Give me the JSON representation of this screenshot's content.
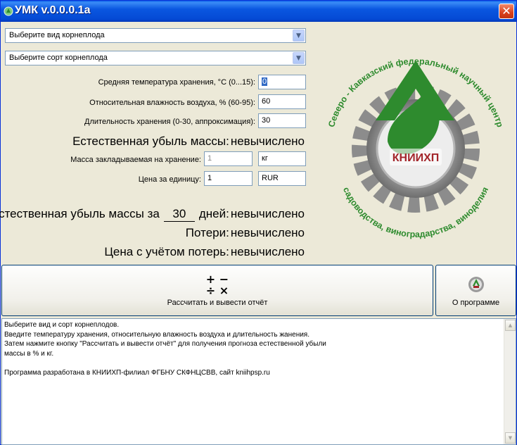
{
  "window": {
    "title": "УМК v.0.0.0.1a",
    "close_glyph": "✕"
  },
  "selectors": {
    "crop_type": "Выберите вид корнеплода",
    "crop_variety": "Выберите сорт корнеплода"
  },
  "params": {
    "temperature_label": "Средняя температура хранения, °С (0...15):",
    "temperature_value": "0",
    "humidity_label": "Относительная влажность воздуха, % (60-95):",
    "humidity_value": "60",
    "duration_label": "Длительность хранения (0-30, аппроксимация):",
    "duration_value": "30"
  },
  "loss": {
    "label": "Естественная убыль массы:",
    "value": "невычислено"
  },
  "mass": {
    "label": "Масса закладываемая на хранение:",
    "value": "1",
    "unit": "кг"
  },
  "price": {
    "label": "Цена за единицу:",
    "value": "1",
    "currency": "RUR"
  },
  "results": {
    "loss_days_prefix": "Естественная убыль массы за",
    "loss_days_value": "30",
    "loss_days_suffix": "дней:",
    "loss_days_result": "невычислено",
    "losses_label": "Потери:",
    "losses_value": "невычислено",
    "price_label": "Цена с учётом потерь:",
    "price_value": "невычислено"
  },
  "buttons": {
    "calc_ops_top": "+ −",
    "calc_ops_bottom": "÷ ×",
    "calc_label": "Рассчитать и вывести отчёт",
    "about_label": "О программе"
  },
  "logo": {
    "arc_top": "Северо - Кавказский федеральный научный центр",
    "arc_bottom": "садоводства, виноградарства, виноделия",
    "center": "КНИИХП"
  },
  "log_lines": [
    "Выберите вид и сорт корнеплодов.",
    "Введите температуру хранения, относительную влажность воздуха и длительность жанения.",
    "Затем нажмите кнопку \"Рассчитать и вывести отчёт\" для получения прогноза естественной убыли",
    "массы в % и кг.",
    "",
    "Программа разработана в КНИИХП-филиал ФГБНУ СКФНЦСВВ, сайт kniihpsp.ru"
  ],
  "icons": {
    "up": "▲",
    "down": "▼",
    "dropdown": "▼"
  },
  "colors": {
    "accent": "#0a57e0",
    "logo_green": "#2e8b2e",
    "logo_red": "#a3262b"
  }
}
